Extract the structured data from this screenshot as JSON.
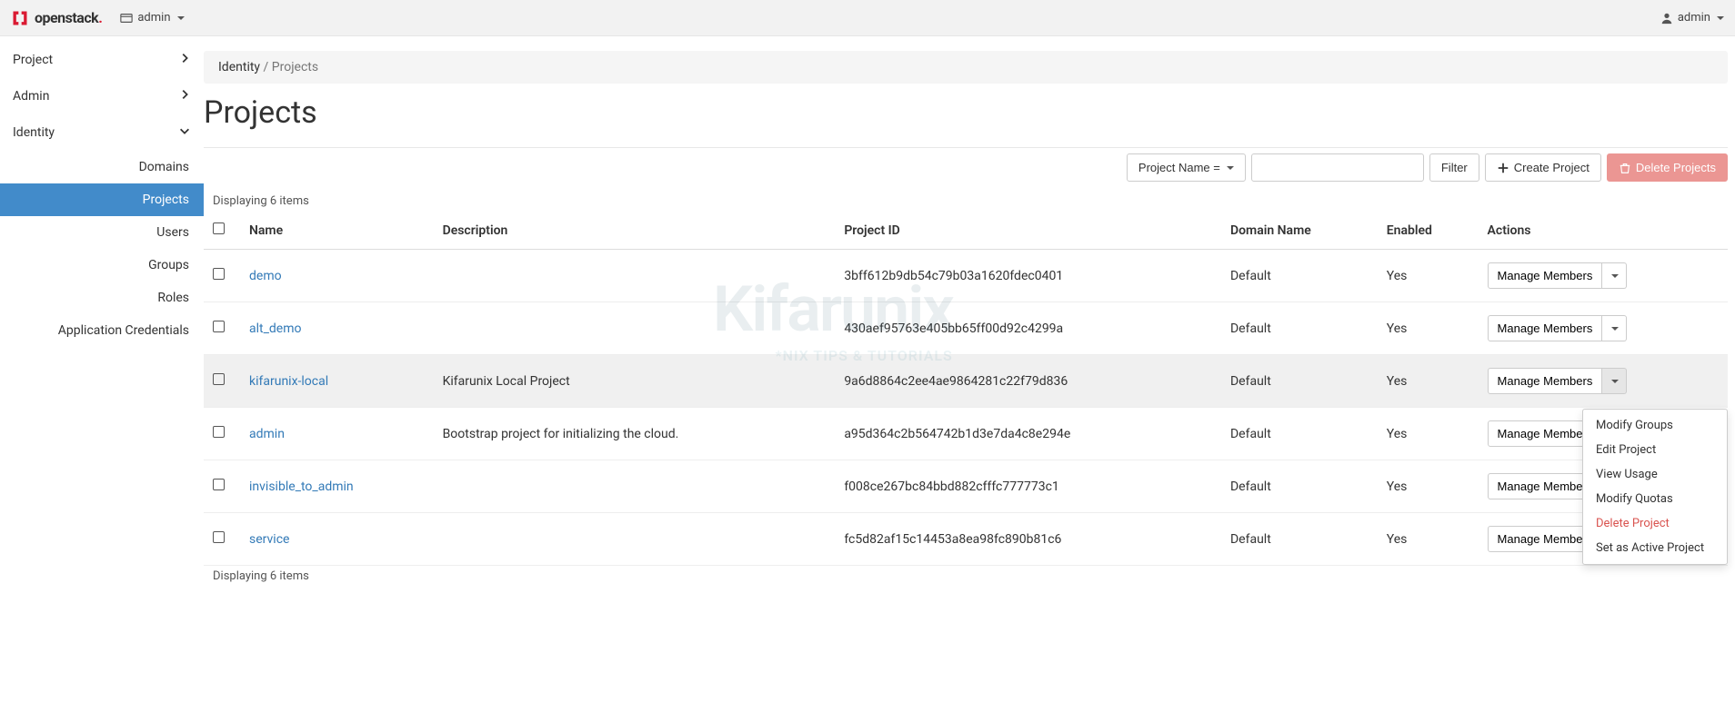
{
  "topbar": {
    "brand": "openstack",
    "context_label": "admin",
    "user_label": "admin"
  },
  "sidebar": {
    "groups": [
      {
        "label": "Project",
        "expanded": false
      },
      {
        "label": "Admin",
        "expanded": false
      },
      {
        "label": "Identity",
        "expanded": true,
        "items": [
          {
            "label": "Domains",
            "active": false
          },
          {
            "label": "Projects",
            "active": true
          },
          {
            "label": "Users",
            "active": false
          },
          {
            "label": "Groups",
            "active": false
          },
          {
            "label": "Roles",
            "active": false
          },
          {
            "label": "Application Credentials",
            "active": false
          }
        ]
      }
    ]
  },
  "breadcrumb": {
    "parent": "Identity",
    "current": "Projects"
  },
  "page": {
    "title": "Projects"
  },
  "toolbar": {
    "filter_menu_label": "Project Name =",
    "filter_input_placeholder": "",
    "filter_button": "Filter",
    "create_button": "Create Project",
    "delete_button": "Delete Projects"
  },
  "table": {
    "count_text_top": "Displaying 6 items",
    "count_text_bottom": "Displaying 6 items",
    "headers": {
      "name": "Name",
      "description": "Description",
      "project_id": "Project ID",
      "domain_name": "Domain Name",
      "enabled": "Enabled",
      "actions": "Actions"
    },
    "action_button_label": "Manage Members",
    "rows": [
      {
        "name": "demo",
        "description": "",
        "project_id": "3bff612b9db54c79b03a1620fdec0401",
        "domain_name": "Default",
        "enabled": "Yes",
        "dropdown_open": false
      },
      {
        "name": "alt_demo",
        "description": "",
        "project_id": "430aef95763e405bb65ff00d92c4299a",
        "domain_name": "Default",
        "enabled": "Yes",
        "dropdown_open": false
      },
      {
        "name": "kifarunix-local",
        "description": "Kifarunix Local Project",
        "project_id": "9a6d8864c2ee4ae9864281c22f79d836",
        "domain_name": "Default",
        "enabled": "Yes",
        "dropdown_open": true
      },
      {
        "name": "admin",
        "description": "Bootstrap project for initializing the cloud.",
        "project_id": "a95d364c2b564742b1d3e7da4c8e294e",
        "domain_name": "Default",
        "enabled": "Yes",
        "dropdown_open": false
      },
      {
        "name": "invisible_to_admin",
        "description": "",
        "project_id": "f008ce267bc84bbd882cfffc777773c1",
        "domain_name": "Default",
        "enabled": "Yes",
        "dropdown_open": false
      },
      {
        "name": "service",
        "description": "",
        "project_id": "fc5d82af15c14453a8ea98fc890b81c6",
        "domain_name": "Default",
        "enabled": "Yes",
        "dropdown_open": false
      }
    ]
  },
  "dropdown_menu": {
    "items": [
      {
        "label": "Modify Groups",
        "danger": false
      },
      {
        "label": "Edit Project",
        "danger": false
      },
      {
        "label": "View Usage",
        "danger": false
      },
      {
        "label": "Modify Quotas",
        "danger": false
      },
      {
        "label": "Delete Project",
        "danger": true
      },
      {
        "label": "Set as Active Project",
        "danger": false
      }
    ]
  },
  "watermark": {
    "big": "Kifarunix",
    "sub": "*NIX TIPS & TUTORIALS"
  }
}
